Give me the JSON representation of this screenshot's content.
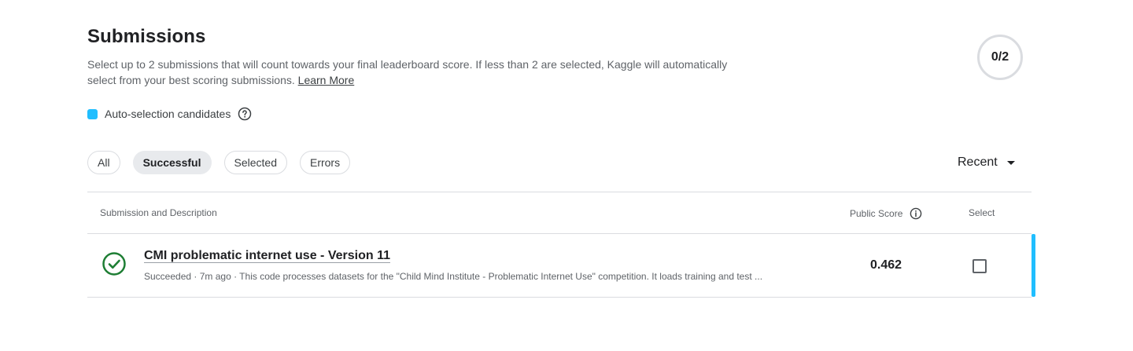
{
  "header": {
    "title": "Submissions",
    "description": "Select up to 2 submissions that will count towards your final leaderboard score. If less than 2 are selected, Kaggle will automatically select from your best scoring submissions.",
    "learn_more": "Learn More",
    "counter": "0/2"
  },
  "legend": {
    "label": "Auto-selection candidates",
    "swatch_color": "#20beff",
    "help_icon": "help-circle-icon"
  },
  "filters": {
    "chips": [
      {
        "label": "All",
        "active": false
      },
      {
        "label": "Successful",
        "active": true
      },
      {
        "label": "Selected",
        "active": false
      },
      {
        "label": "Errors",
        "active": false
      }
    ],
    "sort_label": "Recent"
  },
  "table": {
    "headers": {
      "submission": "Submission and Description",
      "public_score": "Public Score",
      "select": "Select"
    },
    "rows": [
      {
        "title": "CMI problematic internet use - Version 11",
        "meta": "Succeeded · 7m ago · This code processes datasets for the \"Child Mind Institute - Problematic Internet Use\" competition. It loads training and test ...",
        "public_score": "0.462",
        "status_icon": "check-circle-icon",
        "selected": false,
        "auto_candidate": true
      }
    ]
  },
  "colors": {
    "accent": "#20beff",
    "success": "#1e7e34"
  }
}
